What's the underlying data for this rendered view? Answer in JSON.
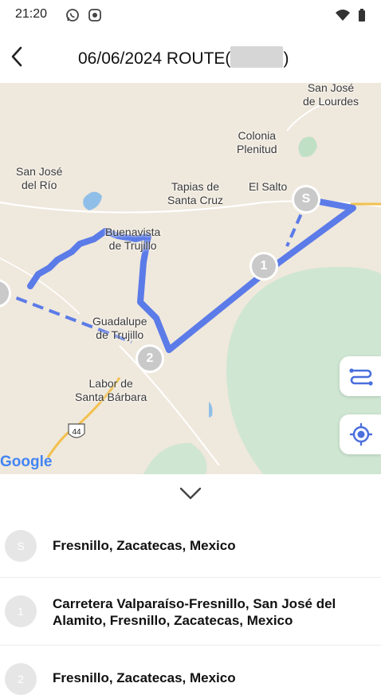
{
  "status_bar": {
    "time": "21:20",
    "left_icons": [
      "whatsapp-icon",
      "record-icon"
    ],
    "right_icons": [
      "wifi-icon",
      "battery-icon"
    ]
  },
  "header": {
    "title_prefix": "06/06/2024 ROUTE(",
    "title_suffix": ")",
    "back_icon": "chevron-left-icon"
  },
  "map": {
    "place_labels": {
      "san_jose_de_lourdes": "San José\nde Lourdes",
      "colonia_plenitud": "Colonia\nPlenitud",
      "san_jose_del_rio": "San José\ndel Río",
      "tapias_de_santa_cruz": "Tapias de\nSanta Cruz",
      "el_salto": "El Salto",
      "buenavista_de_trujillo": "Buenavista\nde Trujillo",
      "guadalupe_de_trujillo": "Guadalupe\nde Trujillo",
      "labor_de_santa_barbara": "Labor de\nSanta Bárbara"
    },
    "highway_shield": "44",
    "attribution": "Google",
    "markers": {
      "start": "S",
      "stop1": "1",
      "stop2": "2"
    },
    "route_color": "#5b7be8",
    "fab_icons": [
      "route-toggle-icon",
      "my-location-icon"
    ]
  },
  "panel": {
    "toggle_icon": "chevron-down-icon"
  },
  "stops": [
    {
      "badge": "S",
      "address": "Fresnillo, Zacatecas, Mexico"
    },
    {
      "badge": "1",
      "address": "Carretera Valparaíso-Fresnillo, San José del Alamito, Fresnillo, Zacatecas, Mexico"
    },
    {
      "badge": "2",
      "address": "Fresnillo, Zacatecas, Mexico"
    }
  ]
}
